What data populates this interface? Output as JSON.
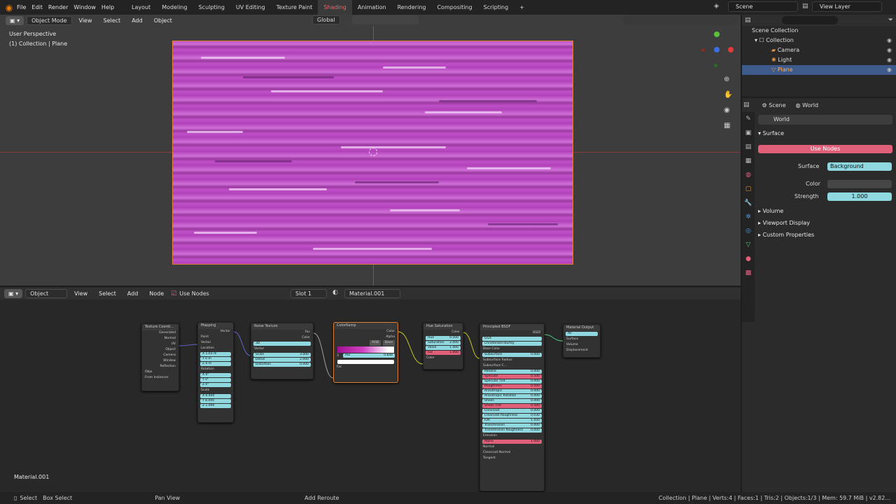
{
  "topbar": {
    "menus": [
      "File",
      "Edit",
      "Render",
      "Window",
      "Help"
    ],
    "workspaces": [
      "Layout",
      "Modeling",
      "Sculpting",
      "UV Editing",
      "Texture Paint",
      "Shading",
      "Animation",
      "Rendering",
      "Compositing",
      "Scripting"
    ],
    "active_workspace": "Shading",
    "add_tab": "+",
    "scene": "Scene",
    "view_layer": "View Layer"
  },
  "viewport": {
    "mode": "Object Mode",
    "menus": [
      "View",
      "Select",
      "Add",
      "Object"
    ],
    "transform": "Global",
    "perspective_label": "User Perspective",
    "collection_label": "(1) Collection | Plane"
  },
  "outliner": {
    "search_placeholder": "",
    "root": "Scene Collection",
    "items": [
      {
        "label": "Collection"
      },
      {
        "label": "Camera"
      },
      {
        "label": "Light"
      },
      {
        "label": "Plane"
      }
    ]
  },
  "properties": {
    "tab_scene": "Scene",
    "tab_world": "World",
    "world_name": "World",
    "section_surface": "Surface",
    "use_nodes": "Use Nodes",
    "surface_label": "Surface",
    "surface_value": "Background",
    "color_label": "Color",
    "strength_label": "Strength",
    "strength_value": "1.000",
    "sections": [
      "Volume",
      "Viewport Display",
      "Custom Properties"
    ]
  },
  "node_editor": {
    "type": "Object",
    "menus": [
      "View",
      "Select",
      "Add",
      "Node"
    ],
    "use_nodes": "Use Nodes",
    "slot": "Slot 1",
    "material": "Material.001",
    "material_label": "Material.001",
    "nodes": {
      "texcoord": {
        "title": "Texture Coordi...",
        "rows": [
          "Generated",
          "Normal",
          "UV",
          "Object",
          "Camera",
          "Window",
          "Reflection"
        ],
        "object_label": "Obje",
        "from_instancer": "From Instancer"
      },
      "mapping": {
        "title": "Mapping",
        "vector_out": "Vector",
        "type_label": "Type:",
        "type_value": "Point",
        "vector_in": "Vector",
        "location": "Location",
        "loc": [
          "X 1.03 m",
          "Y 0 m",
          "Z 0 m"
        ],
        "rotation": "Rotation",
        "rot": [
          "X 0°",
          "Y 0°",
          "Z 0°"
        ],
        "scale": "Scale",
        "scl": [
          "X 0.400",
          "Y 8.000",
          "Z 1.000"
        ]
      },
      "noise": {
        "title": "Noise Texture",
        "fac": "Fac",
        "color": "Color",
        "dim": "3D",
        "vector": "Vector",
        "scale": [
          "Scale",
          "3.000"
        ],
        "detail": [
          "Detail",
          "2.000"
        ],
        "distortion": [
          "Distortion",
          "0.000"
        ]
      },
      "colorramp": {
        "title": "ColorRamp",
        "color": "Color",
        "alpha": "Alpha",
        "mode": "RGB",
        "interp": "Base",
        "index": "3",
        "pos_label": "Pos",
        "pos_value": "0.848",
        "fac": "Fac"
      },
      "huesat": {
        "title": "Hue Saturation",
        "color_out": "Color",
        "hue": [
          "Hue",
          "0.500"
        ],
        "saturation": [
          "Saturation",
          "2.000"
        ],
        "value": [
          "Value",
          "1.400"
        ],
        "fac": [
          "Fac",
          "1.000"
        ],
        "color_in": "Color"
      },
      "bsdf": {
        "title": "Principled BSDF",
        "bsdf_out": "BSDF",
        "dist": "GGX",
        "sss": "Christensen-Burley",
        "rows": [
          [
            "Base Color",
            ""
          ],
          [
            "Subsurface",
            "0.000"
          ],
          [
            "Subsurface Radius",
            ""
          ],
          [
            "Subsurface C...",
            ""
          ],
          [
            "Metallic",
            "0.000"
          ],
          [
            "Specular",
            "0.500"
          ],
          [
            "Specular Tint",
            "0.000"
          ],
          [
            "Roughness",
            "0.500"
          ],
          [
            "Anisotropic",
            "0.000"
          ],
          [
            "Anisotropic Rotation",
            "0.000"
          ],
          [
            "Sheen",
            "0.000"
          ],
          [
            "Sheen Tint",
            "0.500"
          ],
          [
            "Clearcoat",
            "0.000"
          ],
          [
            "Clearcoat Roughness",
            "0.030"
          ],
          [
            "IOR",
            "1.450"
          ],
          [
            "Transmission",
            "0.000"
          ],
          [
            "Transmission Roughness",
            "0.000"
          ],
          [
            "Emission",
            ""
          ],
          [
            "Alpha",
            "1.000"
          ],
          [
            "Normal",
            ""
          ],
          [
            "Clearcoat Normal",
            ""
          ],
          [
            "Tangent",
            ""
          ]
        ]
      },
      "output": {
        "title": "Material Output",
        "target": "All",
        "rows": [
          "Surface",
          "Volume",
          "Displacement"
        ]
      }
    }
  },
  "statusbar": {
    "select": "Select",
    "box_select": "Box Select",
    "pan_view": "Pan View",
    "add_reroute": "Add Reroute",
    "info": "Collection | Plane | Verts:4 | Faces:1 | Tris:2 | Objects:1/3 | Mem: 59.7 MiB | v2.82..."
  },
  "colors": {
    "accent": "#e36a6a",
    "field": "#8fd8e0",
    "pink": "#e0607a",
    "selected": "#3e5a8a"
  }
}
